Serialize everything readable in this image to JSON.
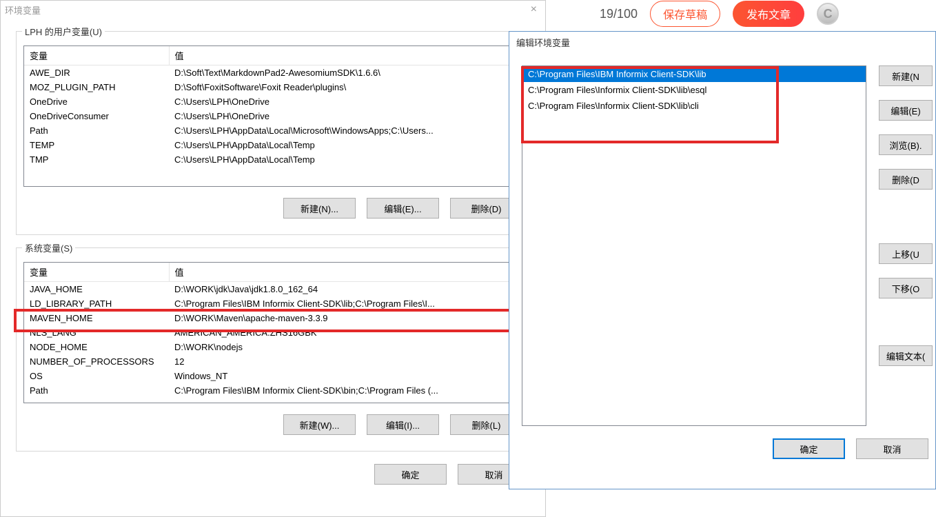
{
  "env_window": {
    "title": "环境变量",
    "user_vars_legend": "LPH 的用户变量(U)",
    "sys_vars_legend": "系统变量(S)",
    "col_var": "变量",
    "col_val": "值",
    "user_vars": [
      {
        "name": "AWE_DIR",
        "value": "D:\\Soft\\Text\\MarkdownPad2-AwesomiumSDK\\1.6.6\\"
      },
      {
        "name": "MOZ_PLUGIN_PATH",
        "value": "D:\\Soft\\FoxitSoftware\\Foxit Reader\\plugins\\"
      },
      {
        "name": "OneDrive",
        "value": "C:\\Users\\LPH\\OneDrive"
      },
      {
        "name": "OneDriveConsumer",
        "value": "C:\\Users\\LPH\\OneDrive"
      },
      {
        "name": "Path",
        "value": "C:\\Users\\LPH\\AppData\\Local\\Microsoft\\WindowsApps;C:\\Users..."
      },
      {
        "name": "TEMP",
        "value": "C:\\Users\\LPH\\AppData\\Local\\Temp"
      },
      {
        "name": "TMP",
        "value": "C:\\Users\\LPH\\AppData\\Local\\Temp"
      }
    ],
    "sys_vars": [
      {
        "name": "JAVA_HOME",
        "value": "D:\\WORK\\jdk\\Java\\jdk1.8.0_162_64"
      },
      {
        "name": "LD_LIBRARY_PATH",
        "value": "C:\\Program Files\\IBM Informix Client-SDK\\lib;C:\\Program Files\\I..."
      },
      {
        "name": "MAVEN_HOME",
        "value": "D:\\WORK\\Maven\\apache-maven-3.3.9"
      },
      {
        "name": "NLS_LANG",
        "value": "AMERICAN_AMERICA.ZHS16GBK"
      },
      {
        "name": "NODE_HOME",
        "value": "D:\\WORK\\nodejs"
      },
      {
        "name": "NUMBER_OF_PROCESSORS",
        "value": "12"
      },
      {
        "name": "OS",
        "value": "Windows_NT"
      },
      {
        "name": "Path",
        "value": "C:\\Program Files\\IBM Informix Client-SDK\\bin;C:\\Program Files (..."
      }
    ],
    "btn_new_n": "新建(N)...",
    "btn_edit_e": "编辑(E)...",
    "btn_del_d": "删除(D)",
    "btn_new_w": "新建(W)...",
    "btn_edit_i": "编辑(I)...",
    "btn_del_l": "删除(L)",
    "btn_ok": "确定",
    "btn_cancel": "取消"
  },
  "edit_window": {
    "title": "编辑环境变量",
    "items": [
      "C:\\Program Files\\IBM Informix Client-SDK\\lib",
      "C:\\Program Files\\Informix Client-SDK\\lib\\esql",
      "C:\\Program Files\\Informix Client-SDK\\lib\\cli"
    ],
    "btn_new": "新建(N",
    "btn_edit": "编辑(E)",
    "btn_browse": "浏览(B).",
    "btn_delete": "删除(D",
    "btn_up": "上移(U",
    "btn_down": "下移(O",
    "btn_edit_text": "编辑文本(",
    "btn_ok": "确定",
    "btn_cancel": "取消"
  },
  "bg": {
    "title_count": "19/100",
    "draft": "保存草稿",
    "publish": "发布文章",
    "logo": "C"
  }
}
